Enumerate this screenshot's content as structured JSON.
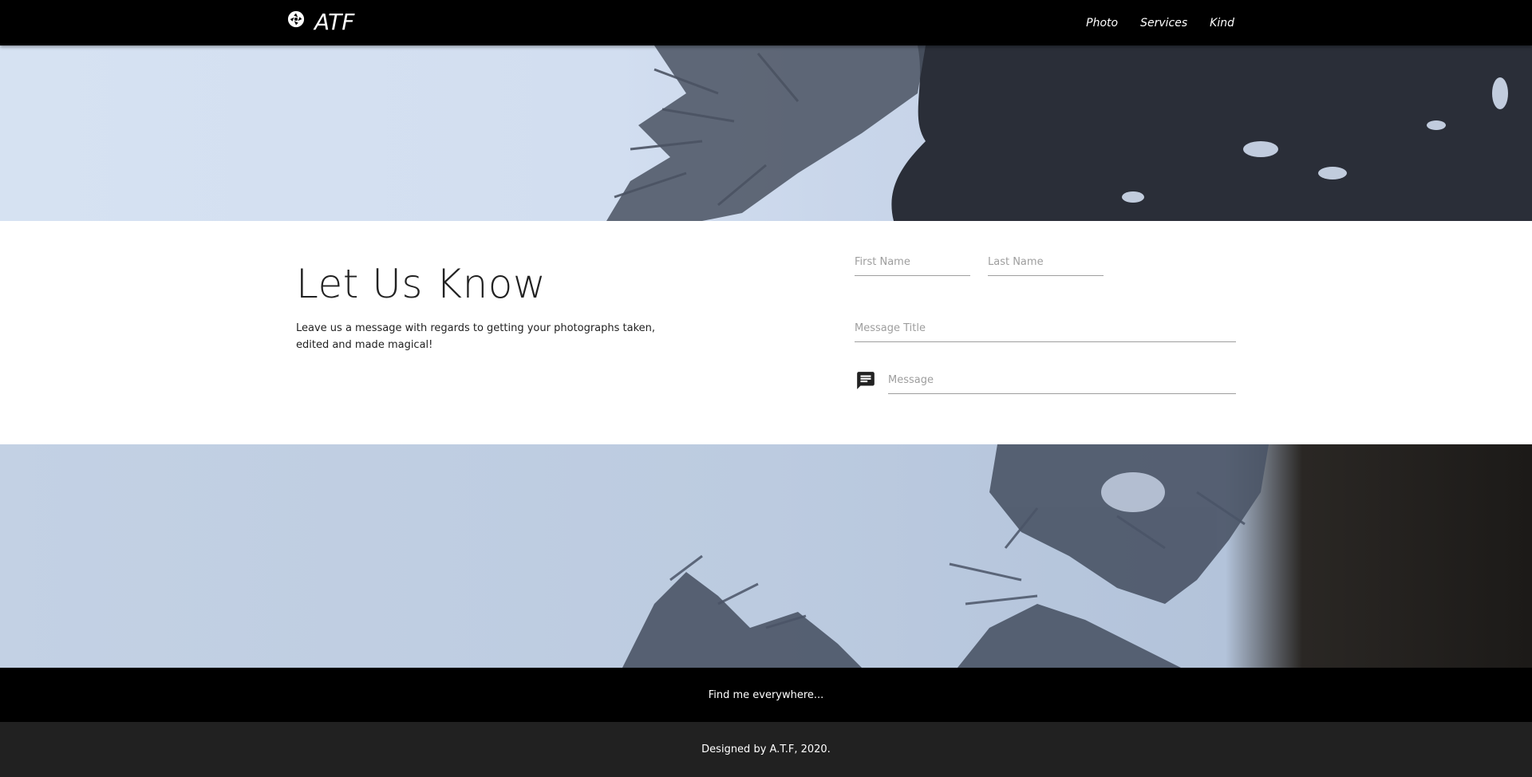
{
  "navbar": {
    "brand": "ATF",
    "brand_icon": "camera-aperture-icon",
    "links": [
      "Photo",
      "Services",
      "Kind"
    ]
  },
  "contact": {
    "heading": "Let Us Know",
    "lead": "Leave us a message with regards to getting your photographs taken, edited and made magical!",
    "first_name_placeholder": "First Name",
    "last_name_placeholder": "Last Name",
    "message_title_placeholder": "Message Title",
    "message_placeholder": "Message",
    "message_icon": "chat-message-icon"
  },
  "footer": {
    "tagline": "Find me everywhere...",
    "credit": "Designed by A.T.F, 2020."
  },
  "colors": {
    "navbar_bg": "#000000",
    "footer_top_bg": "#000000",
    "footer_bottom_bg": "#212121",
    "sky": "#d2def0",
    "foliage": "#3c4350"
  }
}
